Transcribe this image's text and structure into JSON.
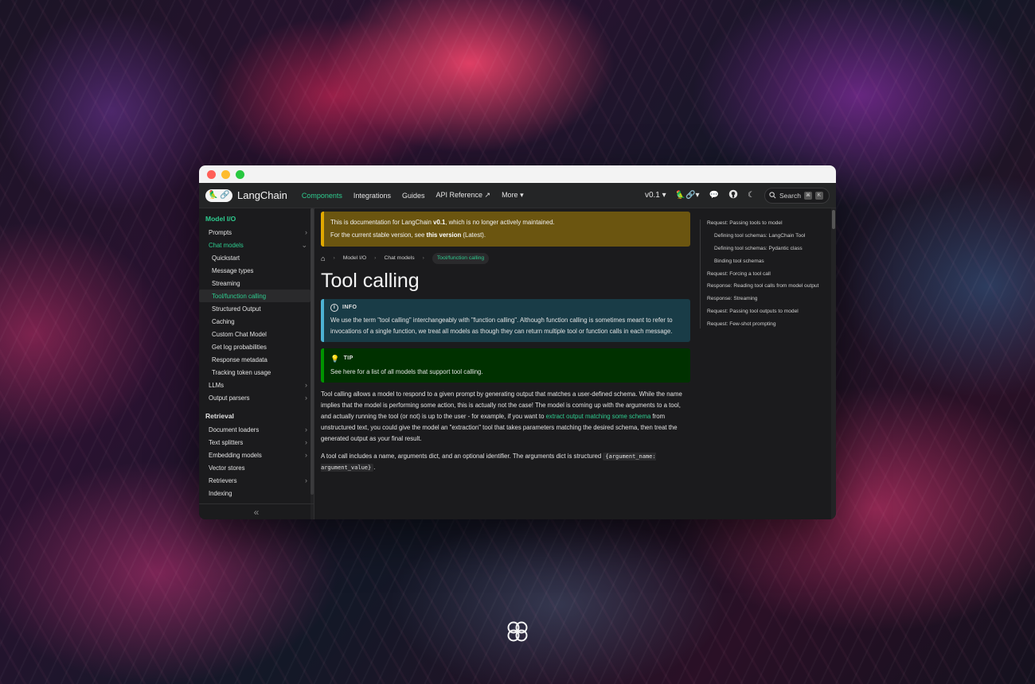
{
  "navbar": {
    "brand": "LangChain",
    "links": [
      "Components",
      "Integrations",
      "Guides",
      "API Reference ↗",
      "More ▾"
    ],
    "active_index": 0,
    "version": "v0.1 ▾",
    "search_label": "Search"
  },
  "sidebar": {
    "section1_title": "Model I/O",
    "items_top": [
      {
        "label": "Prompts",
        "chevron": "›"
      },
      {
        "label": "Chat models",
        "chevron": "⌄"
      }
    ],
    "chat_sub": [
      "Quickstart",
      "Message types",
      "Streaming",
      "Tool/function calling",
      "Structured Output",
      "Caching",
      "Custom Chat Model",
      "Get log probabilities",
      "Response metadata",
      "Tracking token usage"
    ],
    "items_bottom": [
      {
        "label": "LLMs",
        "chevron": "›"
      },
      {
        "label": "Output parsers",
        "chevron": "›"
      }
    ],
    "section2_title": "Retrieval",
    "retrieval_items": [
      {
        "label": "Document loaders",
        "chevron": "›"
      },
      {
        "label": "Text splitters",
        "chevron": "›"
      },
      {
        "label": "Embedding models",
        "chevron": "›"
      },
      {
        "label": "Vector stores",
        "chevron": ""
      },
      {
        "label": "Retrievers",
        "chevron": "›"
      },
      {
        "label": "Indexing",
        "chevron": ""
      }
    ],
    "collapse_glyph": "«"
  },
  "banner": {
    "line1_pre": "This is documentation for LangChain ",
    "line1_version": "v0.1",
    "line1_post": ", which is no longer actively maintained.",
    "line2_pre": "For the current stable version, see ",
    "line2_link": "this version",
    "line2_post": " (Latest)."
  },
  "breadcrumb": {
    "items": [
      "Model I/O",
      "Chat models"
    ],
    "current": "Tool/function calling"
  },
  "page_title": "Tool calling",
  "info": {
    "label": "INFO",
    "text": "We use the term \"tool calling\" interchangeably with \"function calling\". Although function calling is sometimes meant to refer to invocations of a single function, we treat all models as though they can return multiple tool or function calls in each message."
  },
  "tip": {
    "label": "TIP",
    "text": "See here for a list of all models that support tool calling."
  },
  "para1": {
    "pre": "Tool calling allows a model to respond to a given prompt by generating output that matches a user-defined schema. While the name implies that the model is performing some action, this is actually not the case! The model is coming up with the arguments to a tool, and actually running the tool (or not) is up to the user - for example, if you want to ",
    "link": "extract output matching some schema",
    "post": " from unstructured text, you could give the model an \"extraction\" tool that takes parameters matching the desired schema, then treat the generated output as your final result."
  },
  "para2": {
    "pre": "A tool call includes a name, arguments dict, and an optional identifier. The arguments dict is structured ",
    "code": "{argument_name: argument_value}",
    "post": "."
  },
  "toc": [
    {
      "label": "Request: Passing tools to model",
      "sub": false
    },
    {
      "label": "Defining tool schemas: LangChain Tool",
      "sub": true
    },
    {
      "label": "Defining tool schemas: Pydantic class",
      "sub": true
    },
    {
      "label": "Binding tool schemas",
      "sub": true
    },
    {
      "label": "Request: Forcing a tool call",
      "sub": false
    },
    {
      "label": "Response: Reading tool calls from model output",
      "sub": false
    },
    {
      "label": "Response: Streaming",
      "sub": false
    },
    {
      "label": "Request: Passing tool outputs to model",
      "sub": false
    },
    {
      "label": "Request: Few-shot prompting",
      "sub": false
    }
  ],
  "colors": {
    "accent": "#2ecc8f",
    "banner_bg": "#6b5510",
    "info_bg": "#193c47",
    "tip_bg": "#003100"
  }
}
